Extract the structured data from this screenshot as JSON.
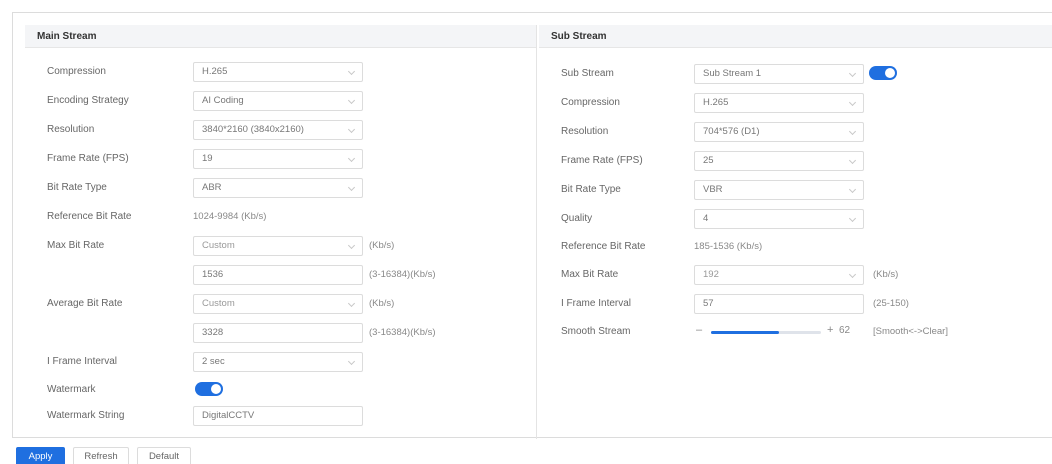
{
  "main": {
    "title": "Main Stream",
    "compression": {
      "label": "Compression",
      "value": "H.265"
    },
    "encoding": {
      "label": "Encoding Strategy",
      "value": "AI Coding"
    },
    "resolution": {
      "label": "Resolution",
      "value": "3840*2160 (3840x2160)"
    },
    "fps": {
      "label": "Frame Rate (FPS)",
      "value": "19"
    },
    "bitrate_type": {
      "label": "Bit Rate Type",
      "value": "ABR"
    },
    "ref_bitrate": {
      "label": "Reference Bit Rate",
      "value": "1024-9984 (Kb/s)"
    },
    "max_bitrate": {
      "label": "Max Bit Rate",
      "mode": "Custom",
      "unit": "(Kb/s)",
      "value": "1536",
      "range": "(3-16384)(Kb/s)"
    },
    "avg_bitrate": {
      "label": "Average Bit Rate",
      "mode": "Custom",
      "unit": "(Kb/s)",
      "value": "3328",
      "range": "(3-16384)(Kb/s)"
    },
    "iframe": {
      "label": "I Frame Interval",
      "value": "2 sec"
    },
    "watermark": {
      "label": "Watermark",
      "enabled": true
    },
    "watermark_string": {
      "label": "Watermark String",
      "value": "DigitalCCTV"
    }
  },
  "sub": {
    "title": "Sub Stream",
    "sub_stream": {
      "label": "Sub Stream",
      "value": "Sub Stream 1",
      "enabled": true
    },
    "compression": {
      "label": "Compression",
      "value": "H.265"
    },
    "resolution": {
      "label": "Resolution",
      "value": "704*576 (D1)"
    },
    "fps": {
      "label": "Frame Rate (FPS)",
      "value": "25"
    },
    "bitrate_type": {
      "label": "Bit Rate Type",
      "value": "VBR"
    },
    "quality": {
      "label": "Quality",
      "value": "4"
    },
    "ref_bitrate": {
      "label": "Reference Bit Rate",
      "value": "185-1536 (Kb/s)"
    },
    "max_bitrate": {
      "label": "Max Bit Rate",
      "value": "192",
      "unit": "(Kb/s)"
    },
    "iframe": {
      "label": "I Frame Interval",
      "value": "57",
      "range": "(25-150)"
    },
    "smooth": {
      "label": "Smooth Stream",
      "minus": "–",
      "plus": "+",
      "value": "62",
      "level": 0.62,
      "hint": "[Smooth<->Clear]"
    }
  },
  "buttons": {
    "apply": "Apply",
    "refresh": "Refresh",
    "default": "Default"
  },
  "colors": {
    "accent": "#1f6fe0"
  }
}
